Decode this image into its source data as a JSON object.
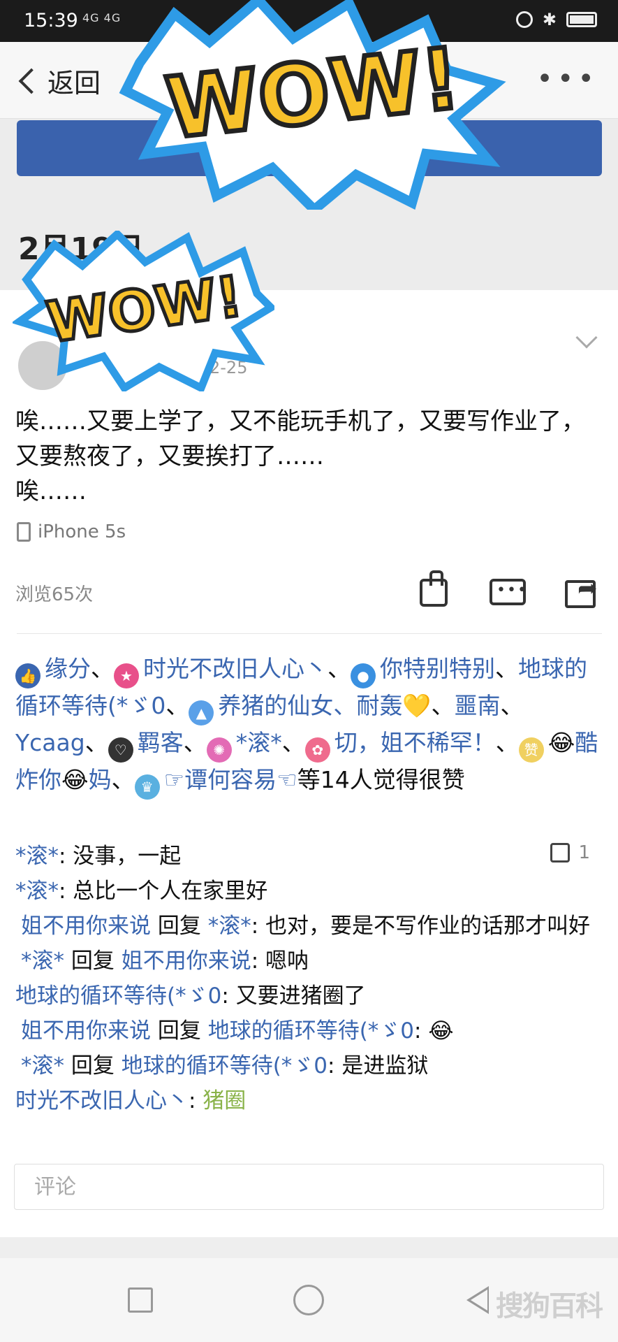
{
  "status_bar": {
    "time": "15:39",
    "signal": "4G 4G"
  },
  "nav": {
    "back_label": "返回"
  },
  "header": {
    "date": "2月19日"
  },
  "post": {
    "post_date": "2-25",
    "content": "唉……又要上学了，又不能玩手机了，又要写作业了，又要熬夜了，又要挨打了……\n唉……",
    "device": "iPhone 5s",
    "views": "浏览65次"
  },
  "likes": {
    "names": [
      "缘分",
      "时光不改旧人心丶",
      "你特别特别",
      "地球的循环等待(*ゞ0",
      "养猪的仙女、耐轰",
      "噩南",
      "Ycaag",
      "羁客",
      "*滚*",
      "切，姐不稀罕！",
      "酷炸你",
      "妈",
      "☞谭何容易☜"
    ],
    "suffix": "等14人觉得很赞"
  },
  "comments": [
    {
      "user": "*滚*",
      "text": ": 没事，一起",
      "like_count": "1"
    },
    {
      "user": "*滚*",
      "text": ": 总比一个人在家里好"
    },
    {
      "user": "姐不用你来说",
      "reply_word": " 回复 ",
      "to": "*滚*",
      "text": ": 也对，要是不写作业的话那才叫好"
    },
    {
      "user": "*滚*",
      "reply_word": " 回复 ",
      "to": "姐不用你来说",
      "text": ": 嗯呐"
    },
    {
      "user": "地球的循环等待(*ゞ0",
      "text": ": 又要进猪圈了"
    },
    {
      "user": "姐不用你来说",
      "reply_word": " 回复 ",
      "to": "地球的循环等待(*ゞ0",
      "text": ": 😂"
    },
    {
      "user": "*滚*",
      "reply_word": " 回复 ",
      "to": "地球的循环等待(*ゞ0",
      "text": ": 是进监狱"
    },
    {
      "user": "时光不改旧人心丶",
      "text": ": ",
      "highlight": "猪圈"
    }
  ],
  "comment_input": {
    "placeholder": "评论"
  },
  "sticker": {
    "text": "WOW!"
  },
  "watermark": "搜狗百科",
  "colors": {
    "link": "#3a66b0",
    "accent_bar": "#3a62ad",
    "green": "#8ab34a",
    "sticker_fill": "#f7c12b",
    "sticker_border": "#2e9be6"
  },
  "icons": [
    "lock-icon",
    "bluetooth-icon",
    "battery-icon",
    "back-chevron-icon",
    "more-dots-icon",
    "thumb-up-icon",
    "comment-icon",
    "share-icon",
    "phone-icon",
    "chevron-down-icon"
  ]
}
